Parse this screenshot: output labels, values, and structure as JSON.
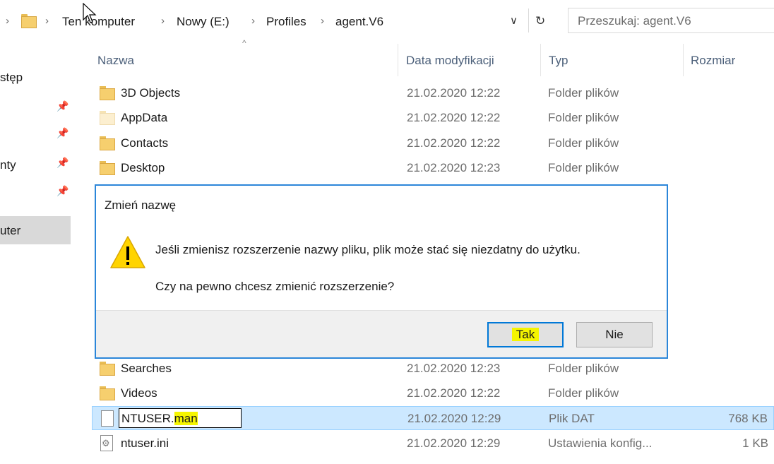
{
  "address": {
    "crumbs": [
      "Ten komputer",
      "Nowy (E:)",
      "Profiles",
      "agent.V6"
    ],
    "search_placeholder": "Przeszukaj: agent.V6"
  },
  "sidebar": {
    "items": [
      {
        "label": "stęp"
      },
      {
        "label": "nty"
      },
      {
        "label": "uter"
      }
    ]
  },
  "columns": {
    "name": "Nazwa",
    "date": "Data modyfikacji",
    "type": "Typ",
    "size": "Rozmiar"
  },
  "rows_top": [
    {
      "name": "3D Objects",
      "date": "21.02.2020 12:22",
      "type": "Folder plików",
      "size": ""
    },
    {
      "name": "AppData",
      "date": "21.02.2020 12:22",
      "type": "Folder plików",
      "size": ""
    },
    {
      "name": "Contacts",
      "date": "21.02.2020 12:22",
      "type": "Folder plików",
      "size": ""
    },
    {
      "name": "Desktop",
      "date": "21.02.2020 12:23",
      "type": "Folder plików",
      "size": ""
    }
  ],
  "rows_bottom": [
    {
      "name": "Searches",
      "date": "21.02.2020 12:23",
      "type": "Folder plików",
      "size": ""
    },
    {
      "name": "Videos",
      "date": "21.02.2020 12:22",
      "type": "Folder plików",
      "size": ""
    },
    {
      "name": "NTUSER.",
      "ext": "man",
      "date": "21.02.2020 12:29",
      "type": "Plik DAT",
      "size": "768 KB"
    },
    {
      "name": "ntuser.ini",
      "date": "21.02.2020 12:29",
      "type": "Ustawienia konfig...",
      "size": "1 KB"
    }
  ],
  "dialog": {
    "title": "Zmień nazwę",
    "message": "Jeśli zmienisz rozszerzenie nazwy pliku, plik może stać się niezdatny do użytku.",
    "question": "Czy na pewno chcesz zmienić rozszerzenie?",
    "yes_label": "Tak",
    "no_label": "Nie"
  },
  "colors": {
    "accent": "#0078d7",
    "highlight": "#f5f500",
    "selection": "#cce8ff"
  }
}
